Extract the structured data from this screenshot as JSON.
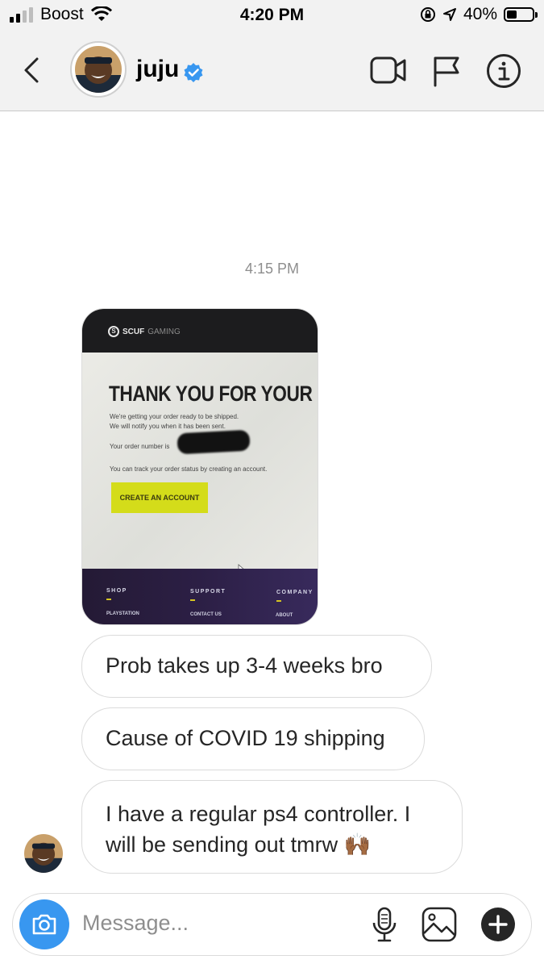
{
  "status_bar": {
    "carrier": "Boost",
    "time": "4:20 PM",
    "battery_percent": "40%",
    "battery_level": 0.4,
    "icons": [
      "signal-icon",
      "wifi-icon",
      "orientation-lock-icon",
      "location-arrow-icon",
      "battery-icon"
    ]
  },
  "header": {
    "username": "juju",
    "verified": true,
    "icons": [
      "back-chevron-icon",
      "video-call-icon",
      "flag-icon",
      "info-icon"
    ]
  },
  "thread": {
    "timestamp": "4:15 PM",
    "shared_photo": {
      "brand": "SCUF",
      "brand_suffix": "GAMING",
      "headline": "THANK YOU FOR YOUR F",
      "line1": "We're getting your order ready to be shipped.",
      "line2": "We will notify you when it has been sent.",
      "order_label": "Your order number is",
      "track_text": "You can track your order status by creating an account.",
      "button_label": "CREATE AN ACCOUNT",
      "footer": {
        "col1_heading": "SHOP",
        "col2_heading": "SUPPORT",
        "col3_heading": "COMPANY",
        "col1_link": "PLAYSTATION",
        "col2_link": "CONTACT US",
        "col3_link": "ABOUT"
      }
    },
    "messages": [
      {
        "text": "Prob takes up 3-4 weeks bro"
      },
      {
        "text": "Cause of COVID 19 shipping"
      },
      {
        "text": "I have a regular ps4 controller. I will be sending out tmrw 🙌🏾"
      }
    ]
  },
  "composer": {
    "placeholder": "Message...",
    "icons": [
      "camera-icon",
      "microphone-icon",
      "gallery-icon",
      "add-icon"
    ]
  },
  "colors": {
    "accent": "#3897f0",
    "verified": "#3897f0",
    "bubble_border": "#dbdbdb",
    "header_bg": "#f2f2f2",
    "timestamp": "#8e8e8e"
  }
}
